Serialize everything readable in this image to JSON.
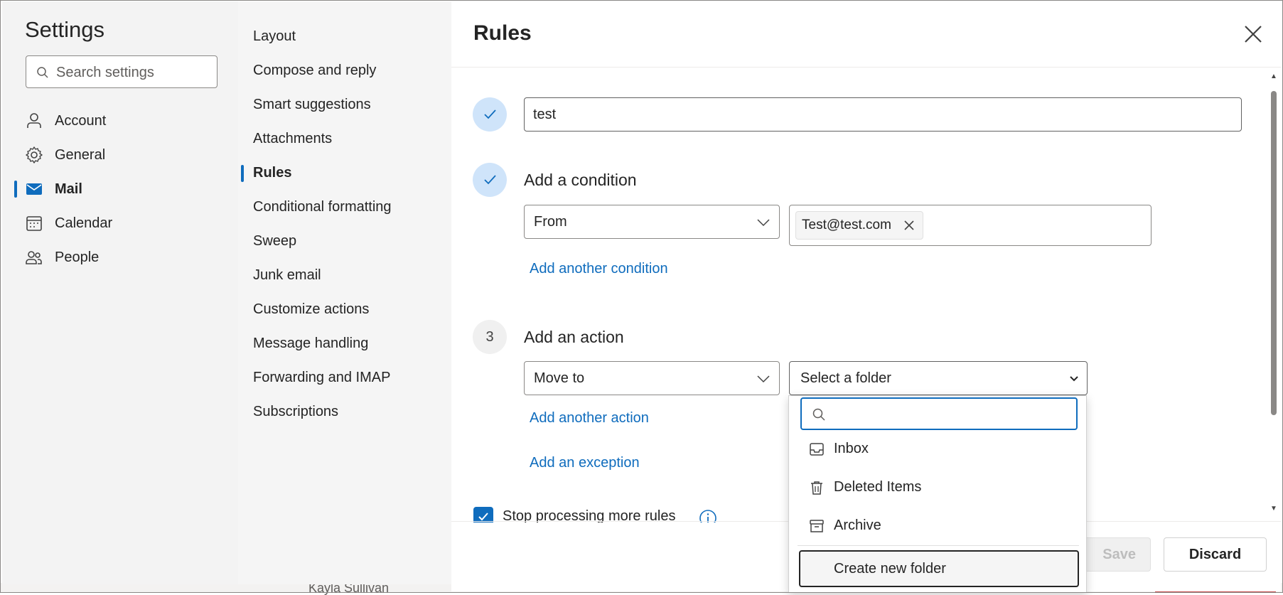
{
  "background": {
    "peek_text": "Kayla Sullivan"
  },
  "settings": {
    "title": "Settings",
    "search_placeholder": "Search settings",
    "nav": [
      {
        "label": "Account",
        "icon": "person-icon"
      },
      {
        "label": "General",
        "icon": "gear-icon"
      },
      {
        "label": "Mail",
        "icon": "mail-icon",
        "active": true
      },
      {
        "label": "Calendar",
        "icon": "calendar-icon"
      },
      {
        "label": "People",
        "icon": "people-icon"
      }
    ]
  },
  "mail_sections": [
    "Layout",
    "Compose and reply",
    "Smart suggestions",
    "Attachments",
    "Rules",
    "Conditional formatting",
    "Sweep",
    "Junk email",
    "Customize actions",
    "Message handling",
    "Forwarding and IMAP",
    "Subscriptions"
  ],
  "active_section": "Rules",
  "rules": {
    "title": "Rules",
    "rule_name": "test",
    "condition": {
      "title": "Add a condition",
      "type": "From",
      "recipient_tag": "Test@test.com",
      "add_link": "Add another condition"
    },
    "action": {
      "step_number": "3",
      "title": "Add an action",
      "type": "Move to",
      "folder_placeholder": "Select a folder",
      "add_link": "Add another action",
      "exception_link": "Add an exception"
    },
    "stop_processing_label": "Stop processing more rules",
    "stop_processing_checked": true,
    "save_label": "Save",
    "discard_label": "Discard"
  },
  "folder_popup": {
    "search_value": "",
    "items": [
      {
        "label": "Inbox",
        "icon": "inbox-icon"
      },
      {
        "label": "Deleted Items",
        "icon": "trash-icon"
      },
      {
        "label": "Archive",
        "icon": "archive-icon"
      }
    ],
    "create_label": "Create new folder"
  },
  "colors": {
    "accent": "#0f6cbd",
    "step_done_bg": "#cfe4fa",
    "sidebar_bg": "#f3f3f3"
  }
}
